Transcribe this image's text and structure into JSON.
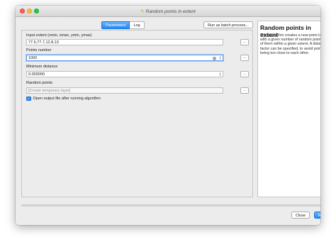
{
  "window": {
    "title": "Random points in extent",
    "title_icon": "pencil-icon"
  },
  "tabs": [
    {
      "label": "Parameters",
      "active": true
    },
    {
      "label": "Log",
      "active": false
    }
  ],
  "batch_button_label": "Run as batch process...",
  "params": {
    "extent": {
      "label": "Input extent (xmin, xmax, ymin, ymax)",
      "value": "77.5,77.7,12.8,13"
    },
    "points_number": {
      "label": "Points number",
      "value": "1000"
    },
    "min_distance": {
      "label": "Minimum distance",
      "value": "0.000000"
    },
    "output": {
      "label": "Random points",
      "placeholder": "[Create temporary layer]"
    },
    "open_output": {
      "label": "Open output file after running algorithm",
      "checked": true
    }
  },
  "browse_label": "...",
  "help": {
    "title": "Random points in extent",
    "body": "This algorithm creates a new point layer with a given number of random points, all of them within a given extent. A distance factor can be specified, to avoid points being too close to each other."
  },
  "progress": 0,
  "buttons": {
    "close": "Close",
    "run": "Run"
  },
  "colors": {
    "accent": "#1f8af6",
    "window_bg": "#ececec"
  }
}
